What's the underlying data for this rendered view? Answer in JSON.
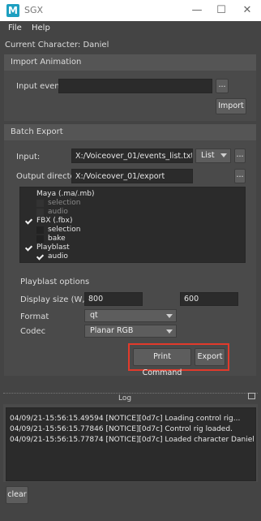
{
  "window": {
    "title": "SGX",
    "app_icon_letter": "M"
  },
  "menu": {
    "items": [
      "File",
      "Help"
    ]
  },
  "current_character": "Current Character: Daniel",
  "import_animation": {
    "title": "Import Animation",
    "input_event_label": "Input event:",
    "input_event_value": "",
    "browse_label": "...",
    "import_label": "Import"
  },
  "batch_export": {
    "title": "Batch Export",
    "input_label": "Input:",
    "input_value": "X:/Voiceover_01/events_list.txt",
    "input_type": "List",
    "browse_label": "...",
    "output_label": "Output directory:",
    "output_value": "X:/Voiceover_01/export",
    "output_browse_label": "...",
    "tree": [
      {
        "label": "Maya (.ma/.mb)",
        "checked": false,
        "enabled": true,
        "level": 0
      },
      {
        "label": "selection",
        "checked": false,
        "enabled": false,
        "level": 1
      },
      {
        "label": "audio",
        "checked": false,
        "enabled": false,
        "level": 1
      },
      {
        "label": "FBX (.fbx)",
        "checked": true,
        "enabled": true,
        "level": 0
      },
      {
        "label": "selection",
        "checked": false,
        "enabled": true,
        "level": 1
      },
      {
        "label": "bake",
        "checked": false,
        "enabled": true,
        "level": 1
      },
      {
        "label": "Playblast",
        "checked": true,
        "enabled": true,
        "level": 0
      },
      {
        "label": "audio",
        "checked": true,
        "enabled": true,
        "level": 1
      }
    ],
    "playblast": {
      "title": "Playblast options",
      "display_size_label": "Display size (W, H)",
      "width": "800",
      "height": "600",
      "format_label": "Format",
      "format_value": "qt",
      "codec_label": "Codec",
      "codec_value": "Planar RGB"
    },
    "print_command_label": "Print Command",
    "export_label": "Export"
  },
  "log": {
    "title": "Log",
    "lines": [
      "04/09/21-15:56:15.49594 [NOTICE][0d7c] Loading control rig...",
      "04/09/21-15:56:15.77846 [NOTICE][0d7c] Control rig loaded.",
      "04/09/21-15:56:15.77874 [NOTICE][0d7c] Loaded character Daniel"
    ],
    "clear_label": "clear"
  },
  "colors": {
    "highlight": "#e23a2b",
    "window_bg": "#444444",
    "field_bg": "#2b2b2b"
  }
}
